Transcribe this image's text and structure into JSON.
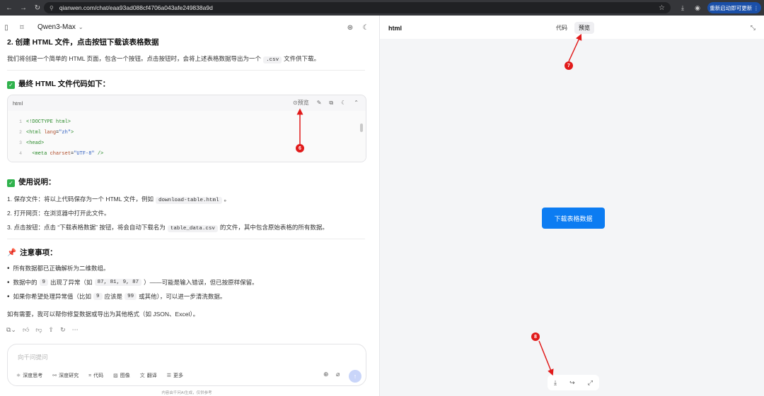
{
  "browser": {
    "url": "qianwen.com/chat/eaa93ad088cf4706a043afe249838a9d",
    "update_label": "重新启动即可更新"
  },
  "header": {
    "model": "Qwen3-Max"
  },
  "content": {
    "section2_title": "2. 创建 HTML 文件，点击按钮下载该表格数据",
    "section2_desc_pre": "我们将创建一个简单的 HTML 页面，包含一个按钮。点击按钮时，会将上述表格数据导出为一个",
    "section2_desc_code": ".csv",
    "section2_desc_post": "文件供下载。",
    "final_title": "最终 HTML 文件代码如下：",
    "code_block": {
      "lang": "html",
      "preview_label": "预览",
      "lines": [
        {
          "num": "1",
          "parts": [
            {
              "t": "<!DOCTYPE html>",
              "c": "tag"
            }
          ]
        },
        {
          "num": "2",
          "parts": [
            {
              "t": "<html ",
              "c": "tag"
            },
            {
              "t": "lang",
              "c": "attr"
            },
            {
              "t": "=",
              "c": ""
            },
            {
              "t": "\"zh\"",
              "c": "str"
            },
            {
              "t": ">",
              "c": "tag"
            }
          ]
        },
        {
          "num": "3",
          "parts": [
            {
              "t": "<head>",
              "c": "tag"
            }
          ]
        },
        {
          "num": "4",
          "parts": [
            {
              "t": "  <meta ",
              "c": "tag"
            },
            {
              "t": "charset",
              "c": "attr"
            },
            {
              "t": "=",
              "c": ""
            },
            {
              "t": "\"UTF-8\"",
              "c": "str"
            },
            {
              "t": " />",
              "c": "tag"
            }
          ]
        }
      ]
    },
    "usage_title": "使用说明：",
    "usage_items": [
      {
        "pre": "1. 保存文件：将以上代码保存为一个 HTML 文件，例如",
        "code": "download-table.html",
        "post": "。"
      },
      {
        "pre": "2. 打开网页：在浏览器中打开此文件。",
        "code": "",
        "post": ""
      },
      {
        "pre": "3. 点击按钮：点击 “下载表格数据” 按钮，将会自动下载名为",
        "code": "table_data.csv",
        "post": "的文件，其中包含原始表格的所有数据。"
      }
    ],
    "notes_title": "注意事项：",
    "notes": [
      {
        "pre": "所有数据都已正确解析为二维数组。",
        "code1": "",
        "mid": "",
        "code2": "",
        "post": ""
      },
      {
        "pre": "数据中的",
        "code1": "9",
        "mid": "出现了异常（如",
        "code2": "87, 81, 9, 87",
        "post": "）——可能是输入错误，但已按原样保留。"
      },
      {
        "pre": "如果你希望处理异常值（比如",
        "code1": "9",
        "mid": "应该是",
        "code2": "99",
        "post": "或其他），可以进一步清洗数据。"
      }
    ],
    "closing": "如有需要，我可以帮你修复数据或导出为其他格式（如 JSON、Excel）。"
  },
  "composer": {
    "placeholder": "向千问提问",
    "tools": [
      "深度思考",
      "深度研究",
      "代码",
      "图像",
      "翻译",
      "更多"
    ],
    "disclaimer": "内容由千问AI生成，仅供参考"
  },
  "preview": {
    "title": "html",
    "tabs": [
      "代码",
      "预览"
    ],
    "active_tab": "预览",
    "download_button": "下载表格数据"
  },
  "annotations": [
    "6",
    "7",
    "8"
  ],
  "colors": {
    "accent_blue": "#0c7cf2",
    "annotation_red": "#e11b1b",
    "check_green": "#2fb24c"
  }
}
